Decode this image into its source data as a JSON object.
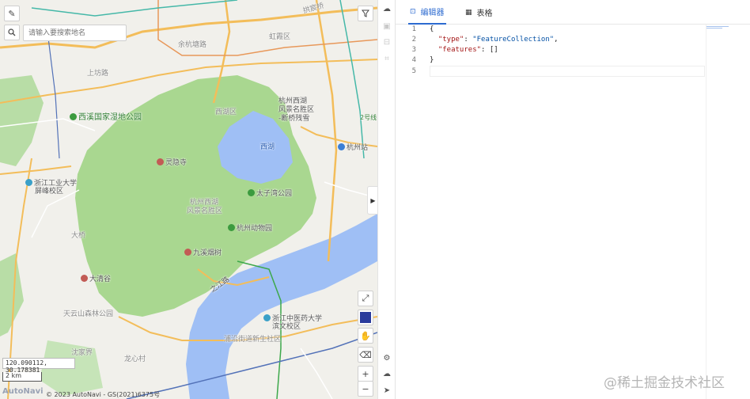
{
  "map": {
    "search_placeholder": "请输入要搜索地名",
    "coordinates": "120.090112, 30.178381",
    "scale_label": "2 km",
    "copyright": "© 2023 AutoNavi - GS(2021)6375号",
    "logo_text": "AutoNavi",
    "labels": {
      "hangzhou_xihu": "杭州西湖",
      "fengjing_qu": "风景名胜区",
      "duanqiao": "-断桥残雪",
      "xihu_qu": "西湖区",
      "xihu_lake": "西湖",
      "xixi": "西溪国家湿地公园",
      "lingyin": "灵隐寺",
      "zhejiang_gongye_1": "浙江工业大学",
      "zhejiang_gongye_2": "屏峰校区",
      "taiziwan": "太子湾公园",
      "xihu_scenic_1": "杭州西湖",
      "xihu_scenic_2": "风景名胜区",
      "zoo": "杭州动物园",
      "jiuxi": "九溪烟树",
      "daqinggu": "大清谷",
      "hangzhou_station": "杭州站",
      "zhijiang_road": "之江路",
      "zcmu_1": "浙江中医药大学",
      "zcmu_2": "滨文校区",
      "puyan": "浦沿街道新生社区",
      "gongshu": "拱宸桥",
      "hongqiao": "虹霞区",
      "shangbu": "上坊路",
      "yuhang": "余杭塘路",
      "line2": "2号线",
      "longmu": "龙心村",
      "shenjia": "沈家界",
      "tianyun": "天云山森林公园",
      "damu": "大桥"
    }
  },
  "tool_strip": {
    "upload_icon": "upload-icon",
    "save_icon": "save-icon",
    "delete_icon": "delete-icon",
    "crop_icon": "crop-icon",
    "settings_icon": "gear-icon",
    "cloud_icon": "cloud-icon",
    "cursor_icon": "cursor-icon"
  },
  "editor": {
    "tabs": [
      {
        "label": "编辑器",
        "active": true
      },
      {
        "label": "表格",
        "active": false
      }
    ],
    "line_numbers": [
      "1",
      "2",
      "3",
      "4",
      "5"
    ],
    "code": {
      "line1": "{",
      "line2_key": "\"type\"",
      "line2_colon": ": ",
      "line2_val": "\"FeatureCollection\"",
      "line2_end": ",",
      "line3_key": "\"features\"",
      "line3_rest": ": []",
      "line4": "}"
    }
  },
  "watermark": "@稀土掘金技术社区",
  "colors": {
    "accent": "#2d6bd0",
    "park_green": "#9fd08f",
    "water_blue": "#9fbff5",
    "road_orange": "#f3bd5a"
  }
}
